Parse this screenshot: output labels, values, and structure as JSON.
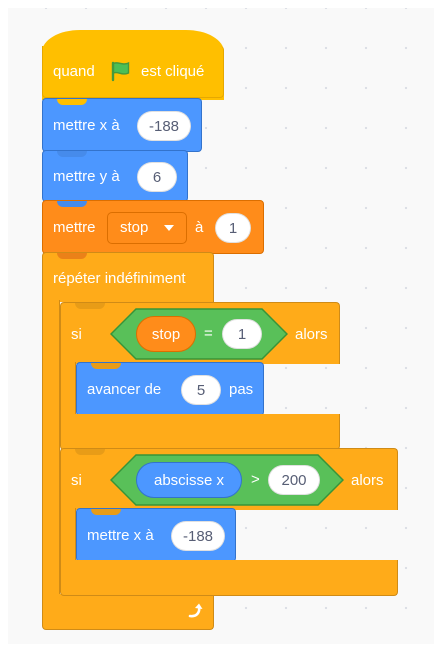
{
  "script": {
    "hat": {
      "prefix": "quand",
      "suffix": "est cliqué",
      "icon": "green-flag-icon"
    },
    "set_x": {
      "label": "mettre x à",
      "value": "-188"
    },
    "set_y": {
      "label": "mettre y à",
      "value": "6"
    },
    "set_var": {
      "label": "mettre",
      "variable": "stop",
      "conj": "à",
      "value": "1"
    },
    "forever": {
      "label": "répéter indéfiniment",
      "loop_icon": "loop-arrow-icon"
    },
    "if1": {
      "label": "si",
      "reporter": "stop",
      "operator": "=",
      "operand": "1",
      "then": "alors",
      "move": {
        "label": "avancer de",
        "value": "5",
        "suffix": "pas"
      }
    },
    "if2": {
      "label": "si",
      "reporter": "abscisse x",
      "operator": ">",
      "operand": "200",
      "then": "alors",
      "set_x": {
        "label": "mettre x à",
        "value": "-188"
      }
    }
  },
  "colors": {
    "event": "#ffbf00",
    "motion": "#4c97ff",
    "variables": "#ff8c1a",
    "control": "#ffab19",
    "operators": "#59c059"
  }
}
